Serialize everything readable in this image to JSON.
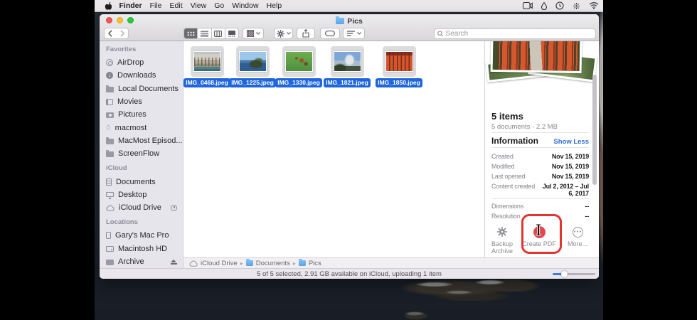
{
  "menu_bar": {
    "app_menus": [
      "Finder",
      "File",
      "Edit",
      "View",
      "Go",
      "Window",
      "Help"
    ],
    "status_icons": [
      "screen-recording",
      "drop",
      "time-machine",
      "accessibility",
      "wifi"
    ]
  },
  "window": {
    "title": "Pics",
    "search_placeholder": "Search"
  },
  "sidebar": {
    "sections": [
      {
        "label": "Favorites",
        "items": [
          {
            "label": "AirDrop"
          },
          {
            "label": "Downloads"
          },
          {
            "label": "Local Documents"
          },
          {
            "label": "Movies"
          },
          {
            "label": "Pictures"
          },
          {
            "label": "macmost"
          },
          {
            "label": "MacMost Episod..."
          },
          {
            "label": "ScreenFlow"
          }
        ]
      },
      {
        "label": "iCloud",
        "items": [
          {
            "label": "Documents"
          },
          {
            "label": "Desktop"
          },
          {
            "label": "iCloud Drive"
          }
        ]
      },
      {
        "label": "Locations",
        "items": [
          {
            "label": "Gary's Mac Pro"
          },
          {
            "label": "Macintosh HD"
          },
          {
            "label": "Archive"
          }
        ]
      }
    ]
  },
  "files": [
    {
      "name": "IMG_0468.jpeg"
    },
    {
      "name": "IMG_1225.jpeg"
    },
    {
      "name": "IMG_1330.jpeg"
    },
    {
      "name": "IMG_1821.jpeg"
    },
    {
      "name": "IMG_1850.jpeg"
    }
  ],
  "preview": {
    "items_count": "5 items",
    "summary": "5 documents - 2.2 MB",
    "info_title": "Information",
    "show_less": "Show Less",
    "info_rows": [
      {
        "label": "Created",
        "value": "Nov 15, 2019"
      },
      {
        "label": "Modified",
        "value": "Nov 15, 2019"
      },
      {
        "label": "Last opened",
        "value": "Nov 15, 2019"
      },
      {
        "label": "Content created",
        "value": "Jul 2, 2012 – Jul 6, 2017"
      }
    ],
    "meta_rows": [
      {
        "label": "Dimensions",
        "value": "--"
      },
      {
        "label": "Resolution",
        "value": "--"
      }
    ],
    "actions": [
      {
        "label": "Backup Archive"
      },
      {
        "label": "Create PDF"
      },
      {
        "label": "More..."
      }
    ]
  },
  "path_bar": {
    "segments": [
      "iCloud Drive",
      "Documents",
      "Pics"
    ]
  },
  "status_bar": {
    "text": "5 of 5 selected, 2.91 GB available on iCloud, uploading 1 item"
  },
  "colors": {
    "selection_blue": "#1f66dd",
    "link_blue": "#2d6fdf",
    "annotation_red": "#e23430"
  }
}
